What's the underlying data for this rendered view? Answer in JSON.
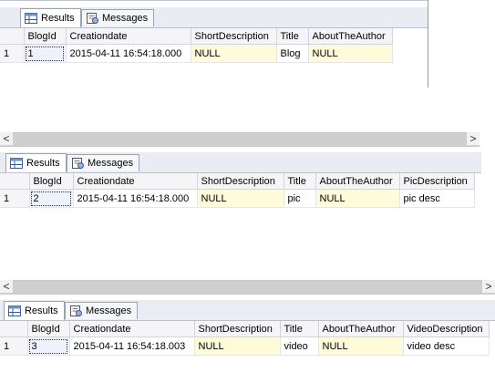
{
  "panels": [
    {
      "tabs": {
        "results": "Results",
        "messages": "Messages"
      },
      "columns": [
        "",
        "BlogId",
        "Creationdate",
        "ShortDescription",
        "Title",
        "AboutTheAuthor"
      ],
      "rows": [
        [
          "1",
          "1",
          "2015-04-11 16:54:18.000",
          "NULL",
          "Blog",
          "NULL"
        ]
      ]
    },
    {
      "scroll": {
        "left": "<",
        "right": ">"
      },
      "tabs": {
        "results": "Results",
        "messages": "Messages"
      },
      "columns": [
        "",
        "BlogId",
        "Creationdate",
        "ShortDescription",
        "Title",
        "AboutTheAuthor",
        "PicDescription"
      ],
      "rows": [
        [
          "1",
          "2",
          "2015-04-11 16:54:18.000",
          "NULL",
          "pic",
          "NULL",
          "pic desc"
        ]
      ]
    },
    {
      "scroll": {
        "left": "<",
        "right": ">"
      },
      "tabs": {
        "results": "Results",
        "messages": "Messages"
      },
      "columns": [
        "",
        "BlogId",
        "Creationdate",
        "ShortDescription",
        "Title",
        "AboutTheAuthor",
        "VideoDescription"
      ],
      "rows": [
        [
          "1",
          "3",
          "2015-04-11 16:54:18.003",
          "NULL",
          "video",
          "NULL",
          "video desc"
        ]
      ]
    }
  ]
}
